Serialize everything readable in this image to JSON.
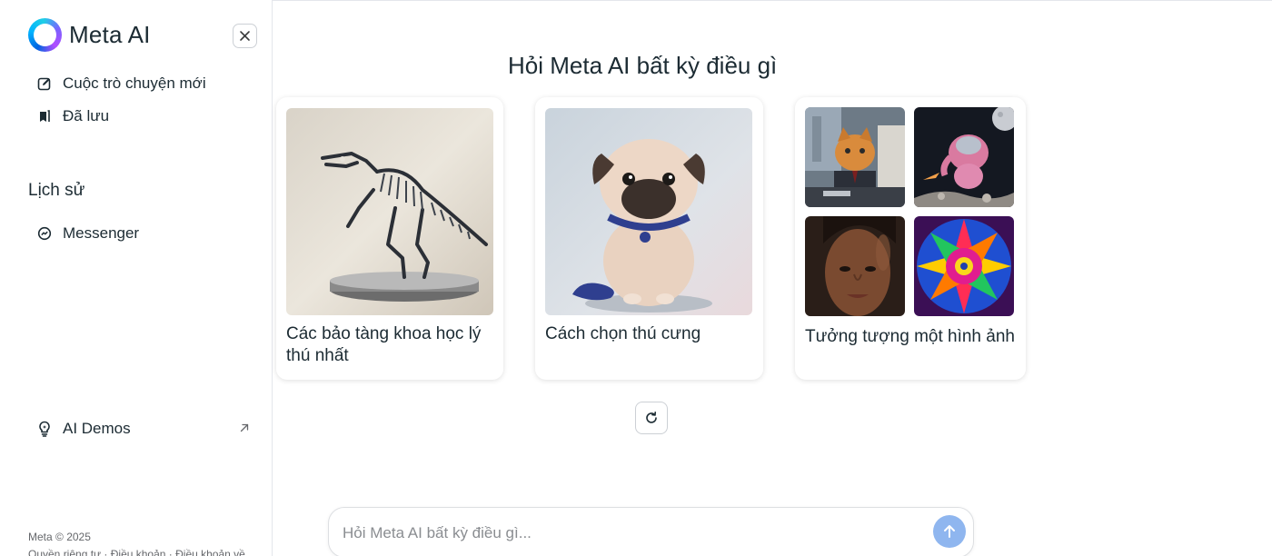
{
  "brand": {
    "name": "Meta AI"
  },
  "sidebar": {
    "nav": [
      {
        "label": "Cuộc trò chuyện mới",
        "icon": "new-chat-icon"
      },
      {
        "label": "Đã lưu",
        "icon": "saved-icon"
      }
    ],
    "history_title": "Lịch sử",
    "history": [
      {
        "label": "Messenger",
        "icon": "messenger-icon"
      }
    ],
    "demos": {
      "label": "AI Demos",
      "icon": "lightbulb-icon"
    },
    "footer": {
      "copyright": "Meta © 2025",
      "links": "Quyền riêng tư · Điều khoản · Điều khoản về"
    }
  },
  "main": {
    "headline": "Hỏi Meta AI bất kỳ điều gì",
    "cards": [
      {
        "title": "Các bảo tàng khoa học lý thú nhất",
        "image": "t-rex-skeleton-image"
      },
      {
        "title": "Cách chọn thú cưng",
        "image": "pug-puppy-image"
      },
      {
        "title": "Tưởng tượng một hình ảnh",
        "images": [
          "cat-businessman-image",
          "pink-elephant-astronaut-image",
          "woman-portrait-image",
          "rainbow-mandala-image"
        ]
      }
    ]
  },
  "composer": {
    "placeholder": "Hỏi Meta AI bất kỳ điều gì..."
  },
  "colors": {
    "send_button": "#8fb6ef",
    "accent": "#0064e0",
    "text": "#1c2b33"
  }
}
